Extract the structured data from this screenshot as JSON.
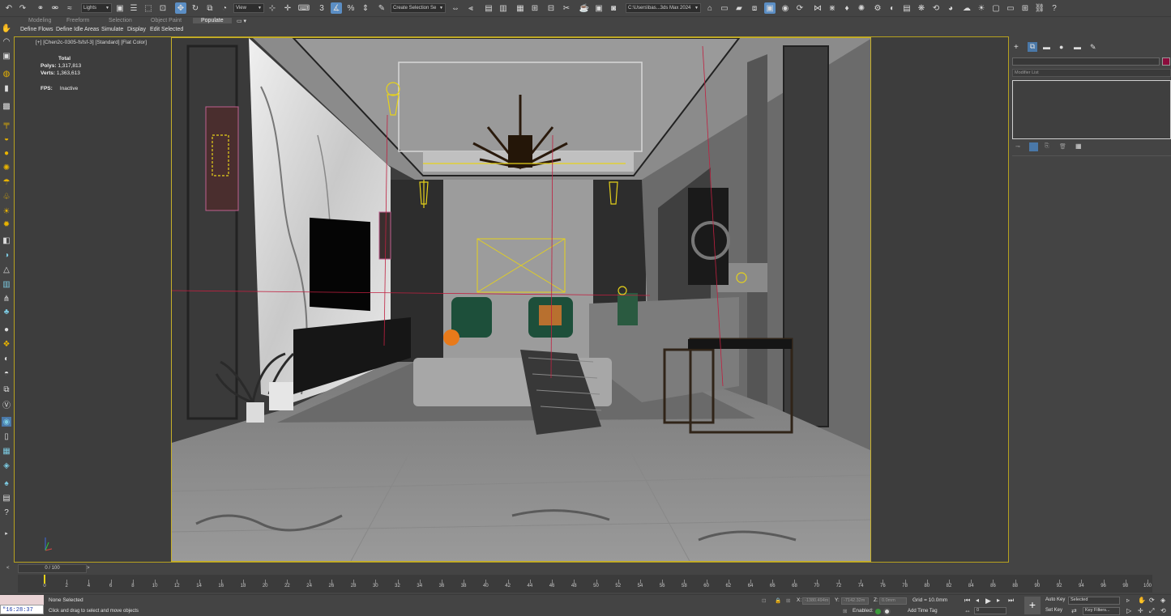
{
  "toolbar": {
    "undo_icon": "undo-icon",
    "filter_dropdown": "Lights",
    "refcoord_dropdown": "View",
    "selection_set_dropdown": "Create Selection Se",
    "project_path_dropdown": "C:\\Users\\bas...3ds Max 2024"
  },
  "ribbon": {
    "tabs": [
      "Modeling",
      "Freeform",
      "Selection",
      "Object Paint",
      "Populate"
    ],
    "buttons": [
      "Define Flows",
      "Define Idle Areas",
      "Simulate",
      "Display",
      "Edit Selected"
    ]
  },
  "viewport": {
    "label": "[+] [Chen2c-0305-fsfsf-3] [Standard] [Flat Color]",
    "stats": {
      "total_label": "Total",
      "polys_label": "Polys:",
      "polys_value": "1,317,813",
      "verts_label": "Verts:",
      "verts_value": "1,363,613",
      "fps_label": "FPS:",
      "fps_value": "Inactive"
    }
  },
  "command_panel": {
    "modifier_list_placeholder": "Modifier List",
    "object_color": "#8a0c3c"
  },
  "timeline": {
    "slider_label": "0 / 100",
    "ticks": [
      "0",
      "2",
      "4",
      "6",
      "8",
      "10",
      "12",
      "14",
      "16",
      "18",
      "20",
      "22",
      "24",
      "26",
      "28",
      "30",
      "32",
      "34",
      "36",
      "38",
      "40",
      "42",
      "44",
      "46",
      "48",
      "50",
      "52",
      "54",
      "56",
      "58",
      "60",
      "62",
      "64",
      "66",
      "68",
      "70",
      "72",
      "74",
      "76",
      "78",
      "80",
      "82",
      "84",
      "86",
      "88",
      "90",
      "92",
      "94",
      "96",
      "98",
      "100"
    ]
  },
  "status": {
    "clock": "\"16:28:37 >>",
    "selection_text": "None Selected",
    "prompt_text": "Click and drag to select and move objects",
    "x_label": "X:",
    "x_value": "-1380.494m",
    "y_label": "Y:",
    "y_value": "-7142.32m",
    "z_label": "Z:",
    "z_value": "0.0mm",
    "grid": "Grid = 10.0mm",
    "enabled_label": "Enabled:",
    "add_time_tag": "Add Time Tag",
    "auto_key": "Auto Key",
    "set_key": "Set Key",
    "selected_dropdown": "Selected",
    "key_filters": "Key Filters...",
    "frame_value": "0"
  },
  "colors": {
    "accent_blue": "#5b8ec4",
    "viewport_border": "#c7b02a",
    "light_gizmo": "#e6d21a"
  }
}
